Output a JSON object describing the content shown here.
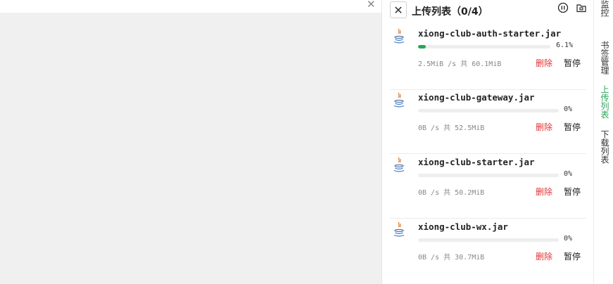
{
  "panel": {
    "title": "上传列表（0/4）",
    "close_icon": "close-icon",
    "pause_all_icon": "pause-circle-icon",
    "folder_icon": "folder-icon"
  },
  "colors": {
    "accent": "#2aa55a",
    "danger": "#e03535",
    "background": "#f0f0f0"
  },
  "uploads": [
    {
      "name": "xiong-club-auth-starter.jar",
      "progress_label": "6.1%",
      "progress": 0.061,
      "speed": "2.5MiB /s 共 60.1MiB",
      "delete_label": "删除",
      "pause_label": "暂停",
      "icon": "java-file-icon"
    },
    {
      "name": "xiong-club-gateway.jar",
      "progress_label": "0%",
      "progress": 0,
      "speed": "0B /s 共 52.5MiB",
      "delete_label": "删除",
      "pause_label": "暂停",
      "icon": "java-file-icon"
    },
    {
      "name": "xiong-club-starter.jar",
      "progress_label": "0%",
      "progress": 0,
      "speed": "0B /s 共 50.2MiB",
      "delete_label": "删除",
      "pause_label": "暂停",
      "icon": "java-file-icon"
    },
    {
      "name": "xiong-club-wx.jar",
      "progress_label": "0%",
      "progress": 0,
      "speed": "0B /s 共 30.7MiB",
      "delete_label": "删除",
      "pause_label": "暂停",
      "icon": "java-file-icon"
    }
  ],
  "sidebar": {
    "tabs": [
      {
        "label": "监控",
        "active": false
      },
      {
        "label": "书签管理",
        "active": false
      },
      {
        "label": "上传列表",
        "active": true
      },
      {
        "label": "下载列表",
        "active": false
      }
    ]
  }
}
